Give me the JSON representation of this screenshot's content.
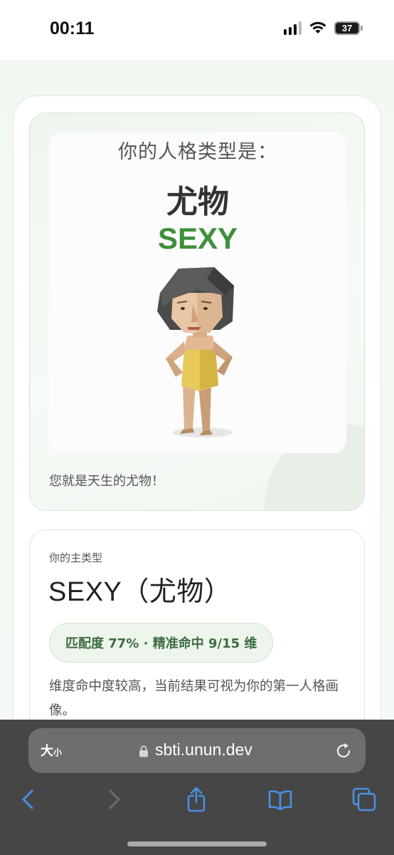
{
  "status": {
    "time": "00:11",
    "battery_level": "37"
  },
  "result": {
    "heading": "你的人格类型是：",
    "name_cn": "尤物",
    "name_en": "SEXY",
    "tagline": "您就是天生的尤物！"
  },
  "main_type": {
    "label": "你的主类型",
    "value_en": "SEXY",
    "value_cn": "（尤物）",
    "match": "匹配度 77% · 精准命中 9/15 维",
    "match_percent": 77,
    "dimensions_hit": 9,
    "dimensions_total": 15,
    "description": "维度命中度较高，当前结果可视为你的第一人格画像。"
  },
  "browser": {
    "reader_big": "大",
    "reader_small": "小",
    "url": "sbti.unun.dev"
  },
  "icons": {
    "back": "chevron-left-icon",
    "forward": "chevron-right-icon",
    "share": "share-icon",
    "bookmarks": "book-icon",
    "tabs": "tabs-icon",
    "reload": "reload-icon",
    "lock": "lock-icon"
  },
  "colors": {
    "accent_green": "#3f8f3c",
    "pill_text": "#3f6c41",
    "browser_accent": "#4a8fe6"
  }
}
